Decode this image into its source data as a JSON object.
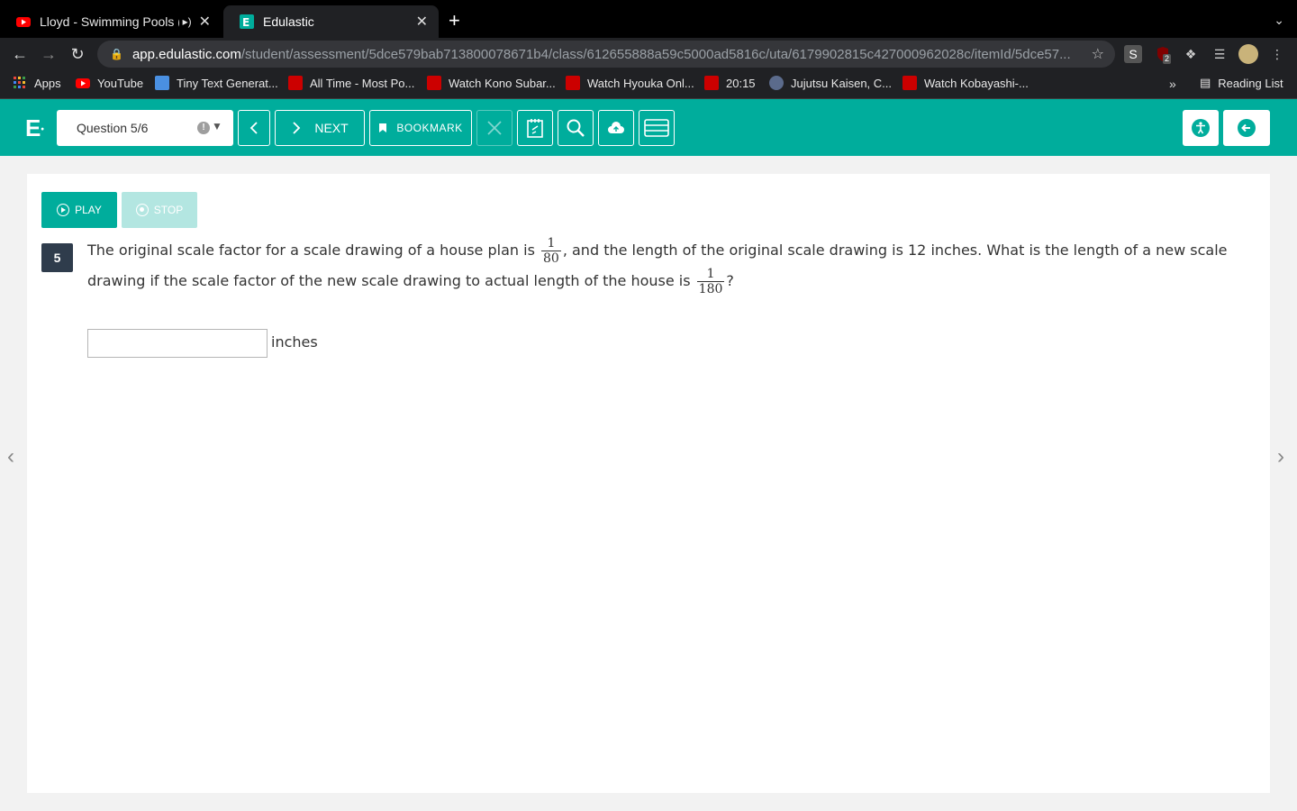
{
  "browser": {
    "tabs": [
      {
        "title": "Lloyd - Swimming Pools (R"
      },
      {
        "title": "Edulastic"
      }
    ],
    "url_host": "app.edulastic.com",
    "url_path": "/student/assessment/5dce579bab713800078671b4/class/612655888a59c5000ad5816c/uta/6179902815c427000962028c/itemId/5dce57...",
    "ext_badge": "2",
    "bookmarks": [
      {
        "label": "Apps",
        "color": "#e8453c"
      },
      {
        "label": "YouTube",
        "color": "#ff0000"
      },
      {
        "label": "Tiny Text Generat...",
        "color": "#4a90e2"
      },
      {
        "label": "All Time - Most Po...",
        "color": "#cc0000"
      },
      {
        "label": "Watch Kono Subar...",
        "color": "#cc0000"
      },
      {
        "label": "Watch Hyouka Onl...",
        "color": "#cc0000"
      },
      {
        "label": "20:15",
        "color": "#cc0000"
      },
      {
        "label": "Jujutsu Kaisen, C...",
        "color": "#5b6b8c"
      },
      {
        "label": "Watch Kobayashi-...",
        "color": "#cc0000"
      }
    ],
    "reading_list": "Reading List"
  },
  "header": {
    "logo": "E",
    "question_select": "Question 5/6",
    "warn_mark": "!",
    "next_label": "NEXT",
    "bookmark_label": "BOOKMARK",
    "accent": "#00ad9c"
  },
  "content": {
    "play_label": "PLAY",
    "stop_label": "STOP",
    "question_number": "5",
    "text_part1": "The original scale factor for a scale drawing of a house plan is",
    "frac1_num": "1",
    "frac1_den": "80",
    "text_part2": ", and the length of the original scale drawing is 12 inches.  What is the length of a new scale drawing if the scale factor of the new scale drawing to actual length of the house is",
    "frac2_num": "1",
    "frac2_den": "180",
    "text_part3": "?",
    "answer_value": "",
    "unit_label": "inches"
  }
}
